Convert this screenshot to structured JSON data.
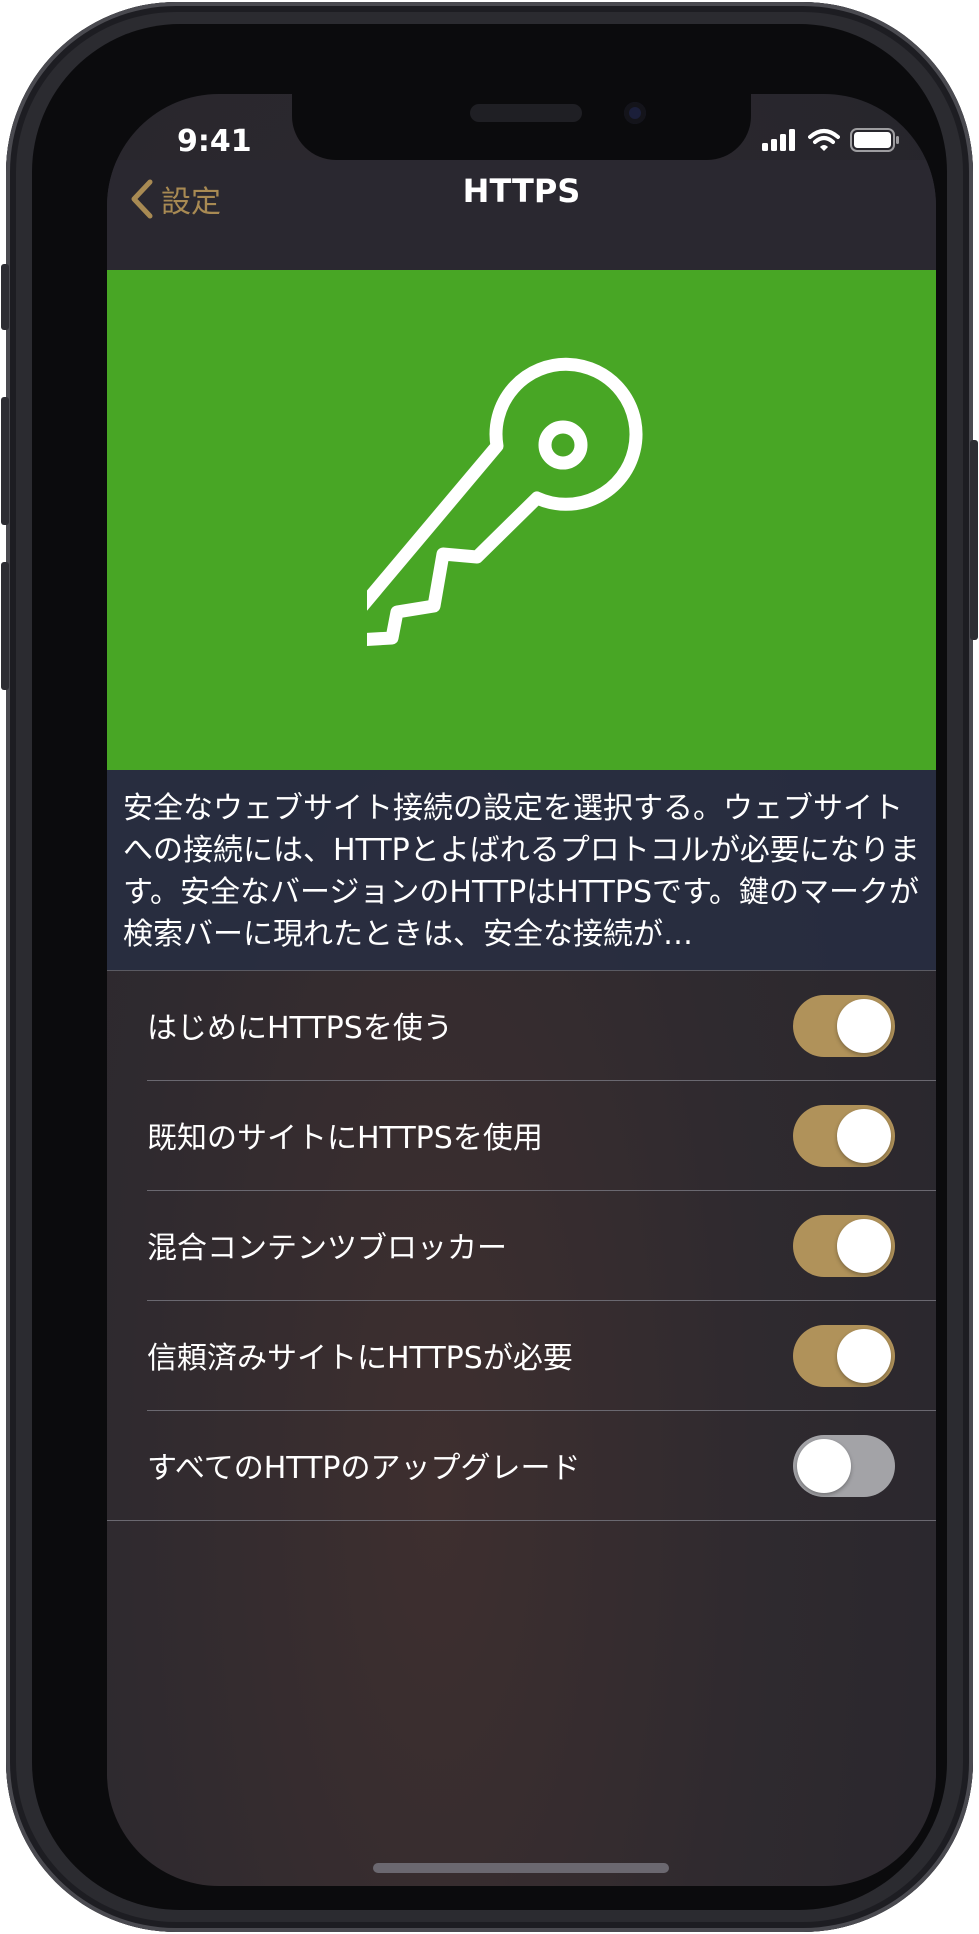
{
  "status": {
    "time": "9:41",
    "icons": [
      "signal-icon",
      "wifi-icon",
      "battery-icon"
    ]
  },
  "nav": {
    "back_label": "設定",
    "title": "HTTPS",
    "back_icon": "chevron-left-icon"
  },
  "hero": {
    "icon": "key-icon",
    "background": "#48A625"
  },
  "description": "安全なウェブサイト接続の設定を選択する。ウェブサイトへの接続には、HTTPとよばれるプロトコルが必要になります。安全なバージョンのHTTPはHTTPSです。鍵のマークが検索バーに現れたときは、安全な接続が…",
  "settings": [
    {
      "label": "はじめにHTTPSを使う",
      "enabled": true
    },
    {
      "label": "既知のサイトにHTTPSを使用",
      "enabled": true
    },
    {
      "label": "混合コンテンツブロッカー",
      "enabled": true
    },
    {
      "label": "信頼済みサイトにHTTPSが必要",
      "enabled": true
    },
    {
      "label": "すべてのHTTPのアップグレード",
      "enabled": false
    }
  ],
  "colors": {
    "accent": "#B0925A",
    "toggle_off": "#A3A3A7",
    "hero_green": "#48A625"
  }
}
